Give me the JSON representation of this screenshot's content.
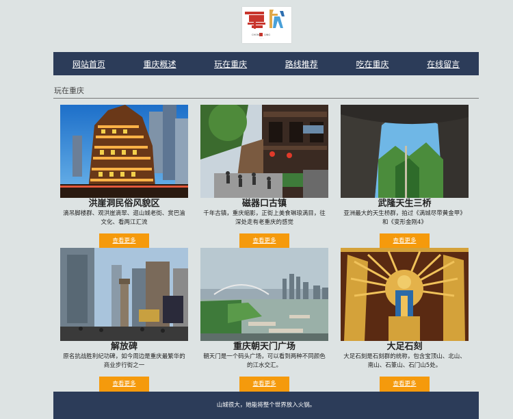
{
  "site": {
    "logo_text": "重庆",
    "logo_sub": "CHONGQING"
  },
  "nav": [
    {
      "label": "网站首页"
    },
    {
      "label": "重庆概述"
    },
    {
      "label": "玩在重庆"
    },
    {
      "label": "路线推荐"
    },
    {
      "label": "吃在重庆"
    },
    {
      "label": "在线留言"
    }
  ],
  "section": {
    "title": "玩在重庆"
  },
  "cards": [
    {
      "title": "洪崖洞民俗风貌区",
      "desc": "滴吊脚楼群、观洪崖滴翠、逛山城老街、赏巴渝文化、看两江汇流",
      "button": "查看更多"
    },
    {
      "title": "磁器口古镇",
      "desc": "千年古镇，重庆缩影，正街上美食琳琅满目，往深处走有老重庆的感觉",
      "button": "查看更多"
    },
    {
      "title": "武隆天生三桥",
      "desc": "亚洲最大的天生桥群，拍过《满城尽带黄金甲》和《变形金刚4》",
      "button": "查看更多"
    },
    {
      "title": "解放碑",
      "desc": "原名抗战胜利纪功碑，如今周边是重庆最繁华的商业步行街之一",
      "button": "查看更多"
    },
    {
      "title": "重庆朝天门广场",
      "desc": "朝天门是一个码头广场，可以看到两种不同颜色的江水交汇。",
      "button": "查看更多"
    },
    {
      "title": "大足石刻",
      "desc": "大足石刻是石刻群的统称，包含宝顶山、北山、南山、石篆山、石门山5处。",
      "button": "查看更多"
    }
  ],
  "footer": {
    "text": "山城很大，她能将整个世界放入火锅。"
  },
  "colors": {
    "nav_bg": "#2c3c59",
    "button": "#f59a0c",
    "page_bg": "#dde3e3"
  }
}
